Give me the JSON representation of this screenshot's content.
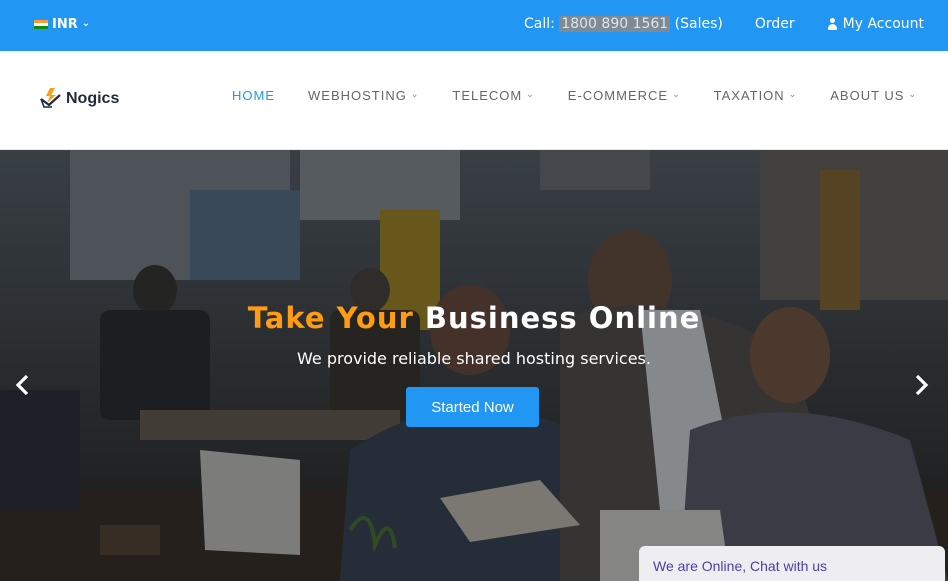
{
  "topbar": {
    "currency": "INR",
    "call_label": "Call:",
    "phone": "1800 890 1561",
    "sales": "(Sales)",
    "order": "Order",
    "account": "My Account"
  },
  "brand": {
    "name": "Nogics"
  },
  "nav": {
    "items": [
      {
        "label": "HOME",
        "active": true
      },
      {
        "label": "WEBHOSTING"
      },
      {
        "label": "TELECOM"
      },
      {
        "label": "E-COMMERCE"
      },
      {
        "label": "TAXATION"
      },
      {
        "label": "ABOUT US"
      }
    ]
  },
  "hero": {
    "headline_accent": "Take Your",
    "headline_rest": "Business Online",
    "subline": "We provide reliable shared hosting services.",
    "cta": "Started Now"
  },
  "chat": {
    "label": "We are Online, Chat with us"
  },
  "colors": {
    "primary": "#2196f3",
    "accent": "#ff9b14"
  }
}
